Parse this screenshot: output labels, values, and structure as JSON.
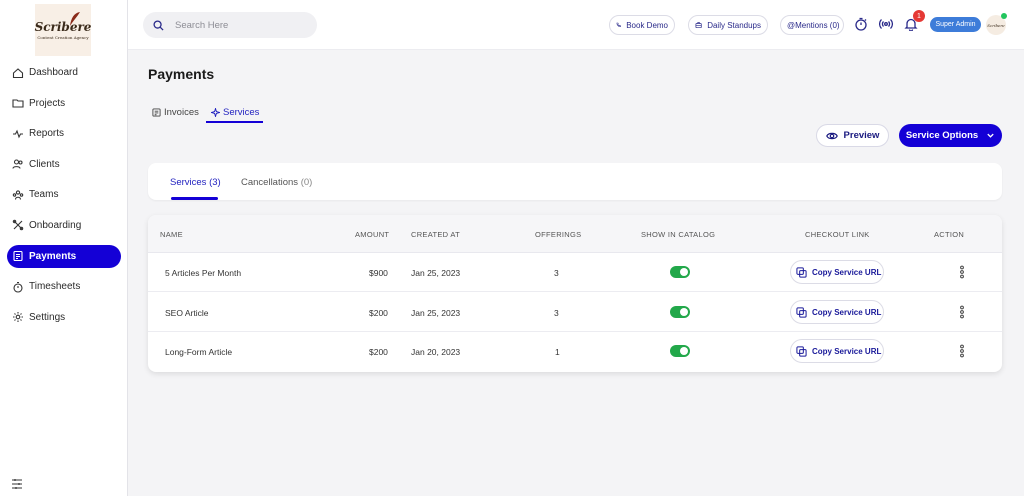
{
  "brand": {
    "name": "Scribere",
    "tagline": "Content Creation Agency"
  },
  "sidebar": {
    "items": [
      {
        "label": "Dashboard",
        "icon": "home-icon"
      },
      {
        "label": "Projects",
        "icon": "folder-icon"
      },
      {
        "label": "Reports",
        "icon": "activity-icon"
      },
      {
        "label": "Clients",
        "icon": "users-icon"
      },
      {
        "label": "Teams",
        "icon": "team-icon"
      },
      {
        "label": "Onboarding",
        "icon": "tools-icon"
      },
      {
        "label": "Payments",
        "icon": "receipt-icon",
        "active": true
      },
      {
        "label": "Timesheets",
        "icon": "stopwatch-icon"
      },
      {
        "label": "Settings",
        "icon": "gear-icon"
      }
    ]
  },
  "topbar": {
    "search_placeholder": "Search Here",
    "book_demo": "Book Demo",
    "daily_standups": "Daily Standups",
    "mentions": "@Mentions (0)",
    "notification_count": "1",
    "role": "Super Admin",
    "avatar_text": "Scribere"
  },
  "page": {
    "title": "Payments",
    "tabs": [
      {
        "label": "Invoices"
      },
      {
        "label": "Services",
        "active": true
      }
    ],
    "preview_label": "Preview",
    "options_label": "Service Options"
  },
  "subtabs": [
    {
      "label": "Services",
      "count": "(3)",
      "active": true
    },
    {
      "label": "Cancellations",
      "count": "(0)"
    }
  ],
  "table": {
    "headers": [
      "NAME",
      "AMOUNT",
      "CREATED AT",
      "OFFERINGS",
      "SHOW IN CATALOG",
      "CHECKOUT LINK",
      "ACTION"
    ],
    "rows": [
      {
        "name": "5 Articles Per Month",
        "amount": "$900",
        "created": "Jan 25, 2023",
        "offerings": "3",
        "catalog": true,
        "link": "Copy Service URL"
      },
      {
        "name": "SEO Article",
        "amount": "$200",
        "created": "Jan 25, 2023",
        "offerings": "3",
        "catalog": true,
        "link": "Copy Service URL"
      },
      {
        "name": "Long-Form Article",
        "amount": "$200",
        "created": "Jan 20, 2023",
        "offerings": "1",
        "catalog": true,
        "link": "Copy Service URL"
      }
    ]
  },
  "colors": {
    "accent": "#1400d6",
    "toggle_on": "#22a84a",
    "badge": "#e53935",
    "admin_pill": "#3d7cd9"
  }
}
